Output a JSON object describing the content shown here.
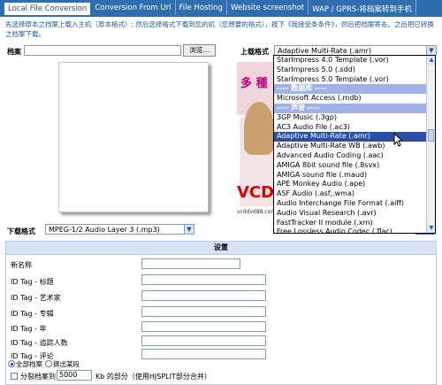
{
  "tabs": [
    {
      "label": "Local File Conversion",
      "active": true
    },
    {
      "label": "Conversion From Url",
      "active": false
    },
    {
      "label": "File Hosting",
      "active": false
    },
    {
      "label": "Website screenshot",
      "active": false
    },
    {
      "label": "WAP / GPRS-将档案转到手机",
      "active": false
    }
  ],
  "instructions": "先选择原本之档案上载入主机（原本格式）; 然后选择格式下载到您的机（您想要的格式），按下《我接受条条件》，然后把档案寄去。之后把已转换之档案下载。",
  "file_label": "档案",
  "browse_label": "浏览...",
  "upload_format_label": "上载格式",
  "upload_format_value": "Adaptive Multi-Rate (.amr)",
  "dropdown_items": [
    {
      "label": "StarImpress 4.0 Template (.vor)",
      "type": "item"
    },
    {
      "label": "StarImpress 5.0 (.sdd)",
      "type": "item"
    },
    {
      "label": "StarImpress 5.0 Template (.vor)",
      "type": "item"
    },
    {
      "label": "---- 数据库 ----",
      "type": "group"
    },
    {
      "label": "Microsoft Access (.mdb)",
      "type": "item"
    },
    {
      "label": "---- 声音 ----",
      "type": "group"
    },
    {
      "label": "3GP Music (.3gp)",
      "type": "item"
    },
    {
      "label": "AC3 Audio File (.ac3)",
      "type": "item"
    },
    {
      "label": "Adaptive Multi-Rate (.amr)",
      "type": "selected"
    },
    {
      "label": "Adaptive Multi-Rate WB (.awb)",
      "type": "item"
    },
    {
      "label": "Advanced Audio Coding (.aac)",
      "type": "item"
    },
    {
      "label": "AMIGA 8bit sound file (.8svx)",
      "type": "item"
    },
    {
      "label": "AMIGA sound file (.maud)",
      "type": "item"
    },
    {
      "label": "APE Monkey Audio (.ape)",
      "type": "item"
    },
    {
      "label": "ASF Audio (.asf,.wma)",
      "type": "item"
    },
    {
      "label": "Audio Interchange File Format (.aiff)",
      "type": "item"
    },
    {
      "label": "Audio Visual Research (.avr)",
      "type": "item"
    },
    {
      "label": "FastTracker II module (.xm)",
      "type": "item"
    },
    {
      "label": "Free Lossless Audio Codec (.flac)",
      "type": "item"
    }
  ],
  "download_format_label": "下载格式",
  "download_format_value": "MPEG-1/2 Audio Layer 3 (.mp3)",
  "ad": {
    "brand": "VCD",
    "url": "vcddvd88.com",
    "top_text": "多 種"
  },
  "settings": {
    "header": "设置",
    "rows": [
      {
        "label": "新名称"
      },
      {
        "label": "ID Tag - 标题"
      },
      {
        "label": "ID Tag - 艺术家"
      },
      {
        "label": "ID Tag - 专辑"
      },
      {
        "label": "ID Tag - 年"
      },
      {
        "label": "ID Tag - 追踪人数"
      },
      {
        "label": "ID Tag - 评论"
      }
    ],
    "radio_all": "全部档案",
    "radio_part": "撷出某段",
    "split_label": "分裂档案到",
    "split_value": "5000",
    "split_suffix": "Kb 的部分（使用HJSPLIT部分合并）"
  },
  "colors": {
    "tab_bar": "#2f6db1",
    "selected_item": "#2a4fa6",
    "group_header": "#9fb3e8",
    "instruction_text": "#1f58a6"
  }
}
